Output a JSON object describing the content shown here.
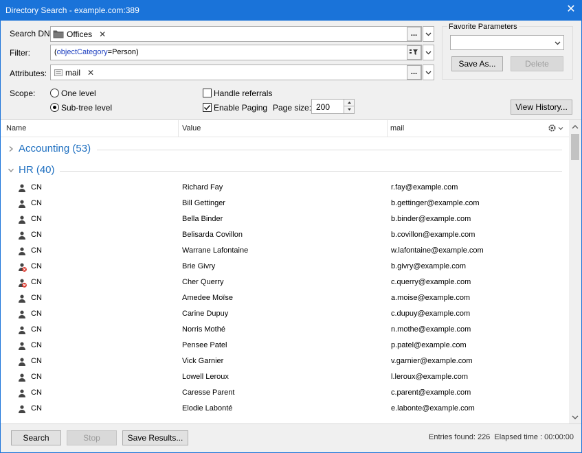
{
  "window": {
    "title": "Directory Search - example.com:389",
    "close_glyph": "✕"
  },
  "search_dn": {
    "label": "Search DN:",
    "chip": "Offices",
    "browse": "...",
    "icon": "folder-icon"
  },
  "filter": {
    "label": "Filter:",
    "prefix": "(",
    "attribute": "objectCategory",
    "rest": "=Person)",
    "icon": "filter-builder-icon"
  },
  "attributes": {
    "label": "Attributes:",
    "chip": "mail",
    "browse": "..."
  },
  "scope": {
    "label": "Scope:",
    "one_level": "One level",
    "subtree": "Sub-tree level",
    "selected": "subtree"
  },
  "options": {
    "handle_referrals": "Handle referrals",
    "handle_referrals_checked": false,
    "enable_paging": "Enable Paging",
    "enable_paging_checked": true,
    "page_size_label": "Page size:",
    "page_size": "200"
  },
  "favorites": {
    "title": "Favorite Parameters",
    "selected": "",
    "save_as": "Save As...",
    "delete": "Delete"
  },
  "view_history": "View History...",
  "columns": {
    "name": "Name",
    "value": "Value",
    "mail": "mail"
  },
  "groups": [
    {
      "label": "Accounting (53)",
      "expanded": false
    },
    {
      "label": "HR (40)",
      "expanded": true
    }
  ],
  "rows": [
    {
      "name": "CN",
      "value": "Richard Fay",
      "mail": "r.fay@example.com",
      "disabled": false
    },
    {
      "name": "CN",
      "value": "Bill Gettinger",
      "mail": "b.gettinger@example.com",
      "disabled": false
    },
    {
      "name": "CN",
      "value": "Bella Binder",
      "mail": "b.binder@example.com",
      "disabled": false
    },
    {
      "name": "CN",
      "value": "Belisarda Covillon",
      "mail": "b.covillon@example.com",
      "disabled": false
    },
    {
      "name": "CN",
      "value": "Warrane Lafontaine",
      "mail": "w.lafontaine@example.com",
      "disabled": false
    },
    {
      "name": "CN",
      "value": "Brie Givry",
      "mail": "b.givry@example.com",
      "disabled": true
    },
    {
      "name": "CN",
      "value": "Cher Querry",
      "mail": "c.querry@example.com",
      "disabled": true
    },
    {
      "name": "CN",
      "value": "Amedee Moïse",
      "mail": "a.moise@example.com",
      "disabled": false
    },
    {
      "name": "CN",
      "value": "Carine Dupuy",
      "mail": "c.dupuy@example.com",
      "disabled": false
    },
    {
      "name": "CN",
      "value": "Norris Mothé",
      "mail": "n.mothe@example.com",
      "disabled": false
    },
    {
      "name": "CN",
      "value": "Pensee Patel",
      "mail": "p.patel@example.com",
      "disabled": false
    },
    {
      "name": "CN",
      "value": "Vick Garnier",
      "mail": "v.garnier@example.com",
      "disabled": false
    },
    {
      "name": "CN",
      "value": "Lowell Leroux",
      "mail": "l.leroux@example.com",
      "disabled": false
    },
    {
      "name": "CN",
      "value": "Caresse Parent",
      "mail": "c.parent@example.com",
      "disabled": false
    },
    {
      "name": "CN",
      "value": "Elodie Labonté",
      "mail": "e.labonte@example.com",
      "disabled": false
    }
  ],
  "footer": {
    "search": "Search",
    "stop": "Stop",
    "save_results": "Save Results...",
    "status": "Entries found: 226  Elapsed time : 00:00:00"
  },
  "colors": {
    "title_bar": "#1a73d9",
    "group_text": "#1e6fc0",
    "filter_attr": "#1e40c0",
    "disabled_badge": "#d93025"
  }
}
